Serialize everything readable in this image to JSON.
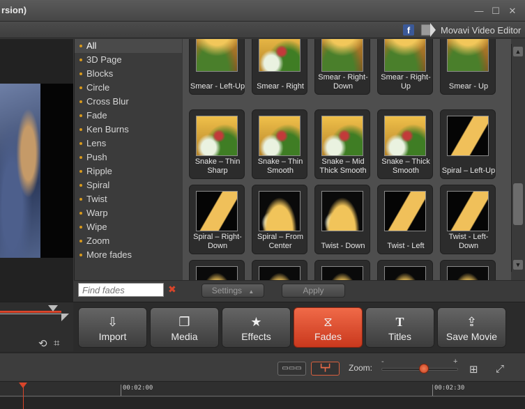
{
  "window": {
    "title": "rsion)",
    "brand": "Movavi Video Editor",
    "facebook_glyph": "f"
  },
  "categories": [
    "All",
    "3D Page",
    "Blocks",
    "Circle",
    "Cross Blur",
    "Fade",
    "Ken Burns",
    "Lens",
    "Push",
    "Ripple",
    "Spiral",
    "Twist",
    "Warp",
    "Wipe",
    "Zoom",
    "More fades"
  ],
  "selected_category": "All",
  "tiles": [
    [
      "Smear - Left-Up",
      "Smear - Right",
      "Smear - Right-Down",
      "Smear - Right-Up",
      "Smear - Up"
    ],
    [
      "Snake – Thin Sharp",
      "Snake – Thin Smooth",
      "Snake – Mid Thick Smooth",
      "Snake – Thick Smooth",
      "Spiral – Left-Up"
    ],
    [
      "Spiral – Right-Down",
      "Spiral – From Center",
      "Twist - Down",
      "Twist - Left",
      "Twist - Left-Down"
    ]
  ],
  "search": {
    "placeholder": "Find fades",
    "clear": "✖"
  },
  "settings_label": "Settings",
  "apply_label": "Apply",
  "toolbar": {
    "import": "Import",
    "media": "Media",
    "effects": "Effects",
    "fades": "Fades",
    "titles": "Titles",
    "save": "Save Movie",
    "active": "Fades",
    "titles_icon": "T"
  },
  "zoom": {
    "label": "Zoom:",
    "minus": "-",
    "plus": "+",
    "level": 0.55
  },
  "ruler": [
    "00:02:00",
    "00:02:30"
  ],
  "colors": {
    "accent": "#e8553a",
    "bullet": "#d99a1c"
  }
}
